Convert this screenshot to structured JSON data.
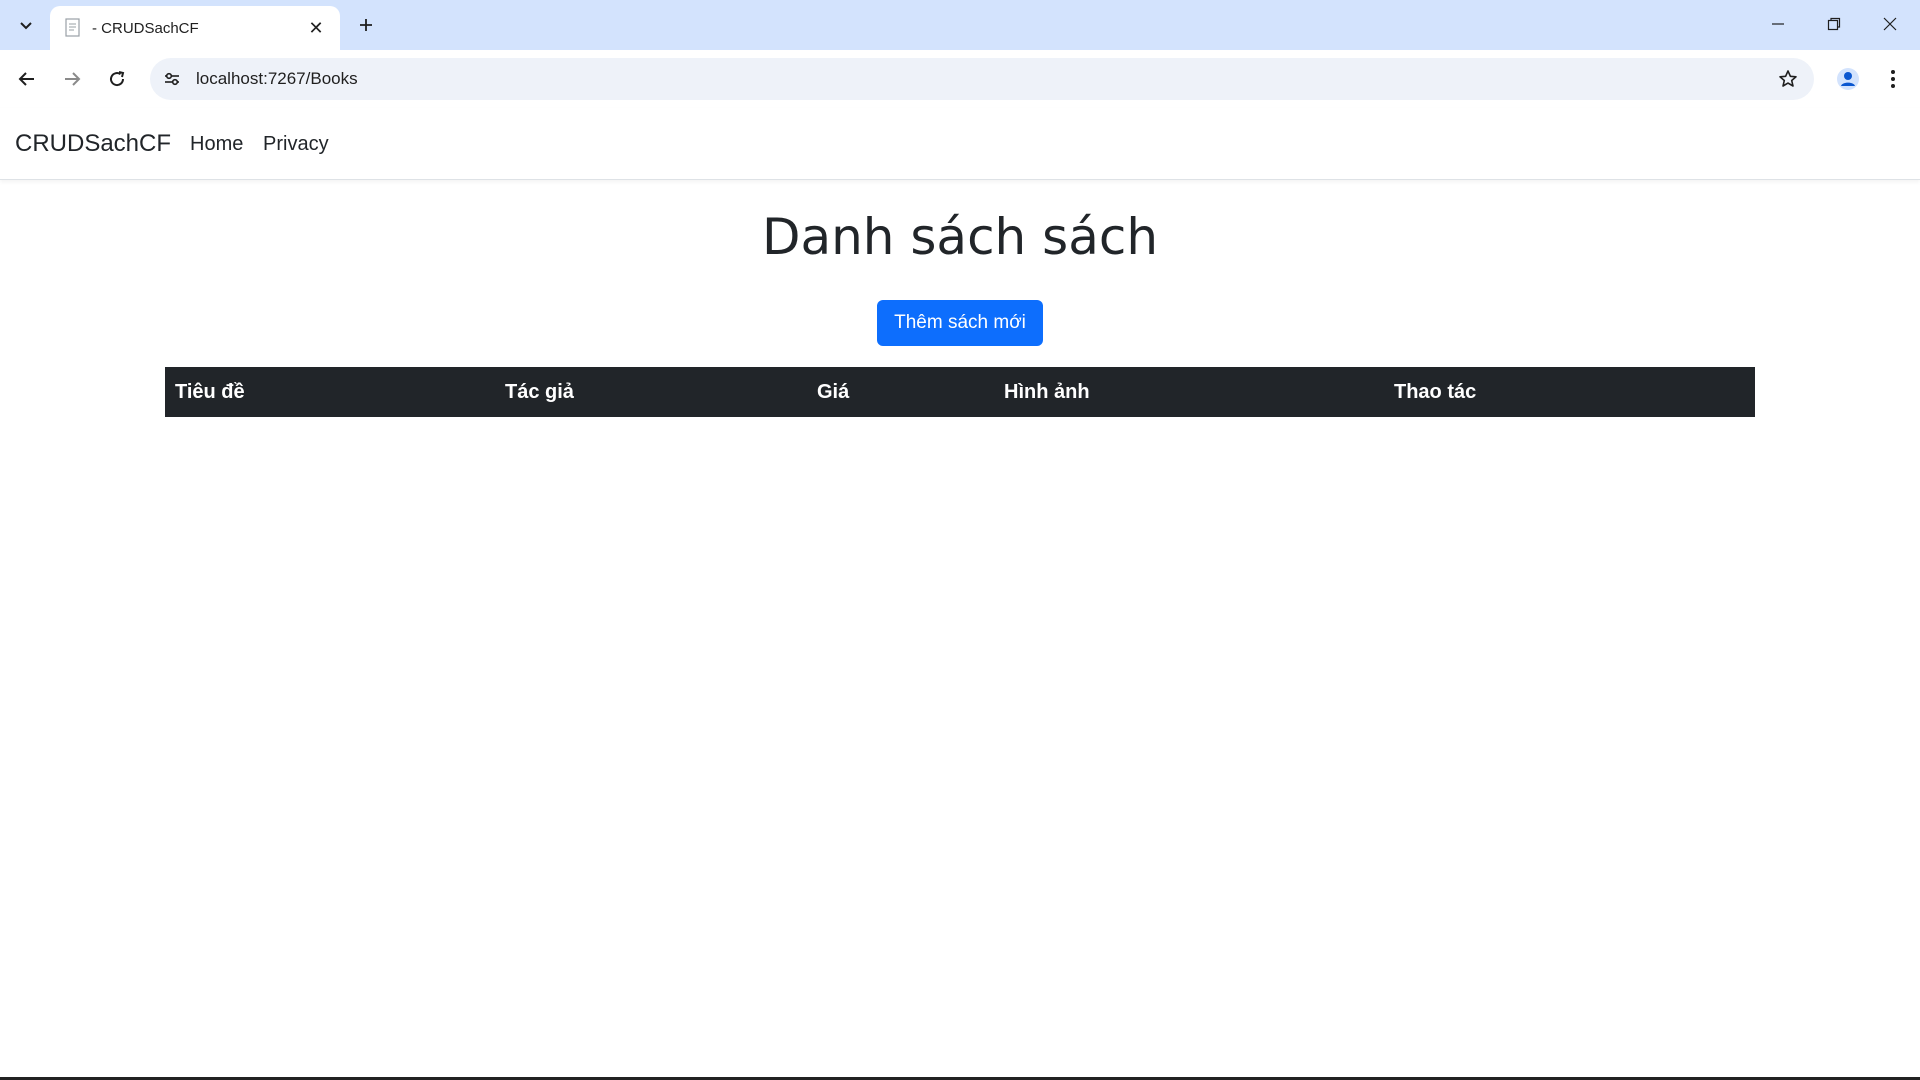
{
  "browser": {
    "tab_title": "- CRUDSachCF",
    "tab_close": "✕",
    "url": "localhost:7267/Books"
  },
  "navbar": {
    "brand": "CRUDSachCF",
    "links": [
      "Home",
      "Privacy"
    ]
  },
  "main": {
    "heading": "Danh sách sách",
    "add_button": "Thêm sách mới",
    "table": {
      "headers": [
        "Tiêu đề",
        "Tác giả",
        "Giá",
        "Hình ảnh",
        "Thao tác"
      ],
      "rows": []
    }
  },
  "colors": {
    "tabstrip": "#d3e3fd",
    "primary": "#0d6efd",
    "table_header": "#212529"
  },
  "icons": [
    "tab-search-icon",
    "favicon-icon",
    "close-icon",
    "plus-icon",
    "minimize-icon",
    "restore-icon",
    "window-close-icon",
    "back-icon",
    "forward-icon",
    "reload-icon",
    "site-settings-icon",
    "star-icon",
    "profile-icon",
    "more-icon"
  ]
}
